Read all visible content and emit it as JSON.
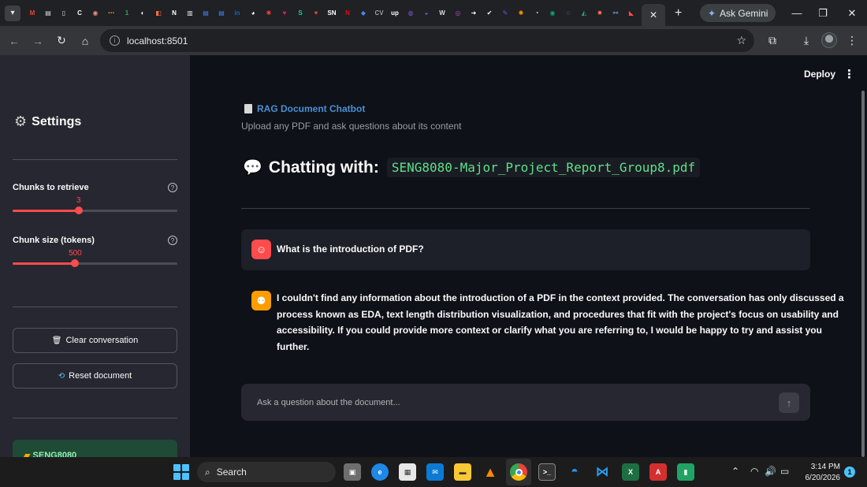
{
  "browser": {
    "url": "localhost:8501",
    "ask_gemini": "Ask Gemini",
    "pinned_tab_icons": [
      {
        "name": "gmail-icon",
        "color": "#ea4335",
        "glyph": "M"
      },
      {
        "name": "docs-icon",
        "color": "#dddddd",
        "glyph": "▤"
      },
      {
        "name": "bookmark-icon",
        "color": "#dddddd",
        "glyph": "▯"
      },
      {
        "name": "c-icon",
        "color": "#ffffff",
        "glyph": "C"
      },
      {
        "name": "circle-icon",
        "color": "#f28b82",
        "glyph": "◉"
      },
      {
        "name": "dots-icon",
        "color": "#f9ab00",
        "glyph": "⋯"
      },
      {
        "name": "number-one-icon",
        "color": "#34a853",
        "glyph": "1"
      },
      {
        "name": "owl-icon",
        "color": "#ffffff",
        "glyph": "◐"
      },
      {
        "name": "app-icon",
        "color": "#ff7043",
        "glyph": "◧"
      },
      {
        "name": "notion-icon",
        "color": "#ffffff",
        "glyph": "N"
      },
      {
        "name": "document-icon",
        "color": "#e8eaed",
        "glyph": "▥"
      },
      {
        "name": "google-docs-icon",
        "color": "#4285f4",
        "glyph": "▤"
      },
      {
        "name": "google-docs-icon-2",
        "color": "#4285f4",
        "glyph": "▤"
      },
      {
        "name": "linkedin-icon",
        "color": "#0a66c2",
        "glyph": "in"
      },
      {
        "name": "github-icon",
        "color": "#ffffff",
        "glyph": "◕"
      },
      {
        "name": "puzzle-icon",
        "color": "#ea4335",
        "glyph": "✱"
      },
      {
        "name": "heart-icon",
        "color": "#e91e63",
        "glyph": "♥"
      },
      {
        "name": "scribd-icon",
        "color": "#1ec8a5",
        "glyph": "S"
      },
      {
        "name": "heart-icon-2",
        "color": "#ea4335",
        "glyph": "♥"
      },
      {
        "name": "sn-icon",
        "color": "#ffffff",
        "glyph": "SN"
      },
      {
        "name": "netflix-icon",
        "color": "#e50914",
        "glyph": "N"
      },
      {
        "name": "shield-icon",
        "color": "#4285f4",
        "glyph": "◆"
      },
      {
        "name": "cv-icon",
        "color": "#9aa0a6",
        "glyph": "CV"
      },
      {
        "name": "up-icon",
        "color": "#ffffff",
        "glyph": "up"
      },
      {
        "name": "planet-icon",
        "color": "#7e57c2",
        "glyph": "◍"
      },
      {
        "name": "tool-icon",
        "color": "#4285f4",
        "glyph": "◒"
      },
      {
        "name": "w-icon",
        "color": "#dddddd",
        "glyph": "W"
      },
      {
        "name": "purple-icon",
        "color": "#ab47bc",
        "glyph": "◎"
      },
      {
        "name": "arrow-icon",
        "color": "#ffffff",
        "glyph": "➜"
      },
      {
        "name": "check-icon",
        "color": "#ffffff",
        "glyph": "✔"
      },
      {
        "name": "rocket-icon",
        "color": "#7c4dff",
        "glyph": "✎"
      },
      {
        "name": "sun-icon",
        "color": "#ff9800",
        "glyph": "✺"
      },
      {
        "name": "chat-icon",
        "color": "#dddddd",
        "glyph": "◔"
      },
      {
        "name": "gpt-icon",
        "color": "#10a37f",
        "glyph": "◉"
      },
      {
        "name": "search-app-icon",
        "color": "#8ab4f8",
        "glyph": "◌"
      },
      {
        "name": "bird-icon",
        "color": "#26a69a",
        "glyph": "◭"
      },
      {
        "name": "mesh-icon",
        "color": "#ff7043",
        "glyph": "✹"
      },
      {
        "name": "molecule-icon",
        "color": "#8ab4f8",
        "glyph": "⚯"
      },
      {
        "name": "streamlit-icon",
        "color": "#ff4b4b",
        "glyph": "◣"
      }
    ]
  },
  "sidebar": {
    "title": "Settings",
    "chunks_label": "Chunks to retrieve",
    "chunks_value": "3",
    "chunks_fraction": 0.4,
    "chunk_size_label": "Chunk size (tokens)",
    "chunk_size_value": "500",
    "chunk_size_fraction": 0.38,
    "clear_label": "Clear conversation",
    "reset_label": "Reset document",
    "success_text": "SENG8080"
  },
  "main": {
    "deploy": "Deploy",
    "app_title": "RAG Document Chatbot",
    "subtitle": "Upload any PDF and ask questions about its content",
    "chatting_with": "Chatting with:",
    "filename": "SENG8080-Major_Project_Report_Group8.pdf",
    "messages": [
      {
        "role": "user",
        "text": "What is the introduction of PDF?"
      },
      {
        "role": "assistant",
        "lines": [
          "I couldn't find any information about the introduction of a PDF in the context provided. The conversation has only discussed a",
          "process known as EDA, text length distribution visualization, and procedures that fit with the project's focus on usability and",
          "accessibility. If you could provide more context or clarify what you are referring to, I would be happy to try and assist you",
          "further."
        ]
      }
    ],
    "input_placeholder": "Ask a question about the document..."
  },
  "taskbar": {
    "search": "Search",
    "time": "3:14 PM",
    "date": "6/20/2026",
    "notifications": "1"
  },
  "colors": {
    "accent": "#ff4b4b",
    "sidebar_bg": "#262730",
    "main_bg": "#0e1117",
    "code_text": "#5ee089",
    "link": "#4a8fd4"
  }
}
